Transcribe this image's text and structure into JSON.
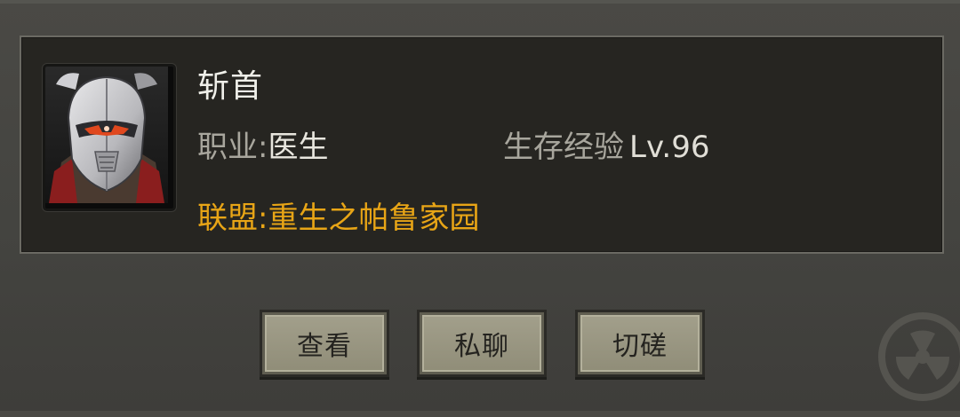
{
  "player": {
    "name": "斩首",
    "job_label": "职业:",
    "job_value": "医生",
    "level_label": "生存经验",
    "level_value": "Lv.96",
    "alliance_label": "联盟:",
    "alliance_value": "重生之帕鲁家园",
    "avatar_icon": "armored-helmet-portrait"
  },
  "actions": {
    "view_label": "查看",
    "chat_label": "私聊",
    "duel_label": "切磋"
  },
  "decor": {
    "corner_icon": "radiation-icon"
  },
  "colors": {
    "alliance": "#e8a516",
    "name": "#efefe9",
    "label": "#a8a69d",
    "button_face": "#9a977f",
    "panel": "#262521"
  }
}
